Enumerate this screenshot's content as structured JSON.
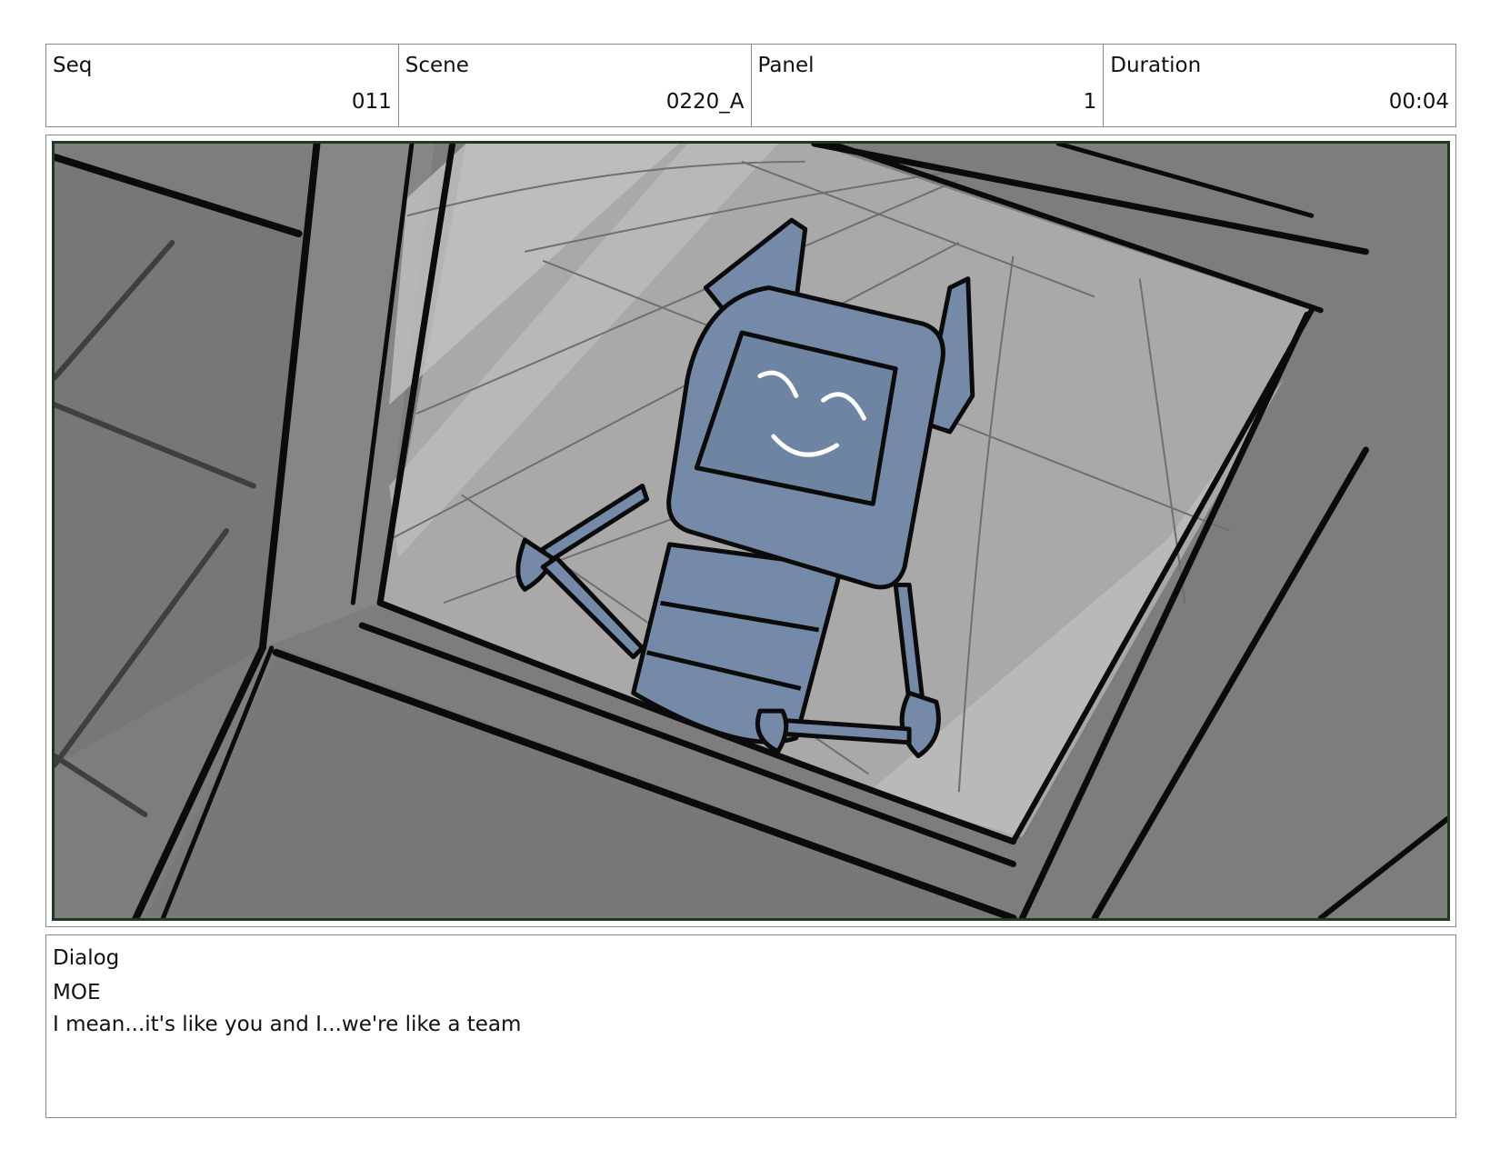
{
  "header": {
    "seq": {
      "label": "Seq",
      "value": "011"
    },
    "scene": {
      "label": "Scene",
      "value": "0220_A"
    },
    "panel": {
      "label": "Panel",
      "value": "1"
    },
    "duration": {
      "label": "Duration",
      "value": "00:04"
    }
  },
  "dialog": {
    "label": "Dialog",
    "speaker": "MOE",
    "line": "I mean...it's like you and I...we're like a team"
  },
  "colors": {
    "floor": "#7d7d7d",
    "glass": "#b4b4b4",
    "robot": "#7589a8",
    "frame_border": "#1e3a1e"
  }
}
